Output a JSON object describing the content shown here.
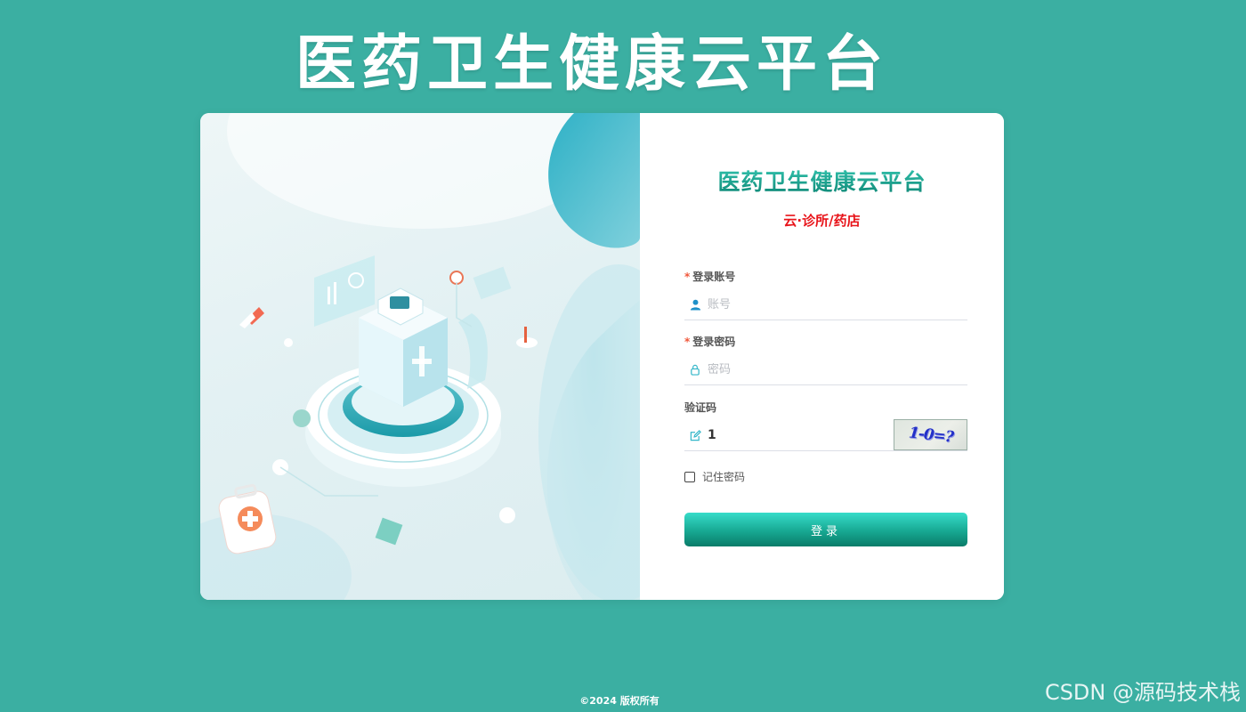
{
  "page": {
    "title": "医药卫生健康云平台",
    "footer": "©2024 版权所有",
    "watermark": "CSDN @源码技术栈"
  },
  "login_form": {
    "title": "医药卫生健康云平台",
    "subtitle": "云·诊所/药店",
    "account": {
      "label": "登录账号",
      "required_mark": "*",
      "placeholder": "账号",
      "value": "",
      "icon": "user-icon"
    },
    "password": {
      "label": "登录密码",
      "required_mark": "*",
      "placeholder": "密码",
      "value": "",
      "icon": "lock-icon"
    },
    "captcha": {
      "label": "验证码",
      "value": "1",
      "image_text": "1-0=?",
      "icon": "edit-icon"
    },
    "remember": {
      "label": "记住密码",
      "checked": false
    },
    "submit_label": "登录"
  },
  "colors": {
    "background": "#3bafa2",
    "accent": "#1fa48f",
    "subtitle": "#e8141a",
    "required": "#f0573a"
  }
}
